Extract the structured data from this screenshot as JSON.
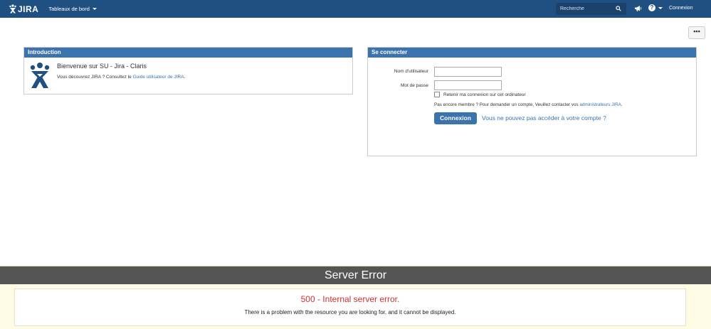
{
  "header": {
    "logo_text": "JIRA",
    "dashboards_label": "Tableaux de bord",
    "search_placeholder": "Recherche",
    "help_icon_char": "?",
    "login_link": "Connexion"
  },
  "toolbar": {
    "more_label": "•••"
  },
  "intro": {
    "title": "Introduction",
    "welcome": "Bienvenue sur SU - Jira - Claris",
    "discover_prefix": "Vous découvrez JIRA ? Consultez le ",
    "guide_link": "Guide utilisateur de JIRA",
    "discover_suffix": "."
  },
  "login": {
    "title": "Se connecter",
    "username_label": "Nom d'utilisateur",
    "password_label": "Mot de passe",
    "remember_label": "Retenir ma connexion sur cet ordinateur",
    "not_member_prefix": "Pas encore membre ? Pour demander un compte, Veuillez contacter vos ",
    "admins_link": "administrateurs JIRA",
    "not_member_suffix": ".",
    "submit_label": "Connexion",
    "forgot_link": "Vous ne pouvez pas accéder à votre compte ?"
  },
  "error": {
    "title": "Server Error",
    "code": "500 - Internal server error.",
    "message": "There is a problem with the resource you are looking for, and it cannot be displayed."
  },
  "colors": {
    "nav": "#205081",
    "panel_header": "#3b73af",
    "link": "#3b73af",
    "error_red": "#cc3333",
    "error_bar": "#555555"
  },
  "icons": [
    "jira-logo-icon",
    "search-icon",
    "megaphone-icon",
    "help-icon",
    "caret-down-icon",
    "jira-man-icon"
  ]
}
